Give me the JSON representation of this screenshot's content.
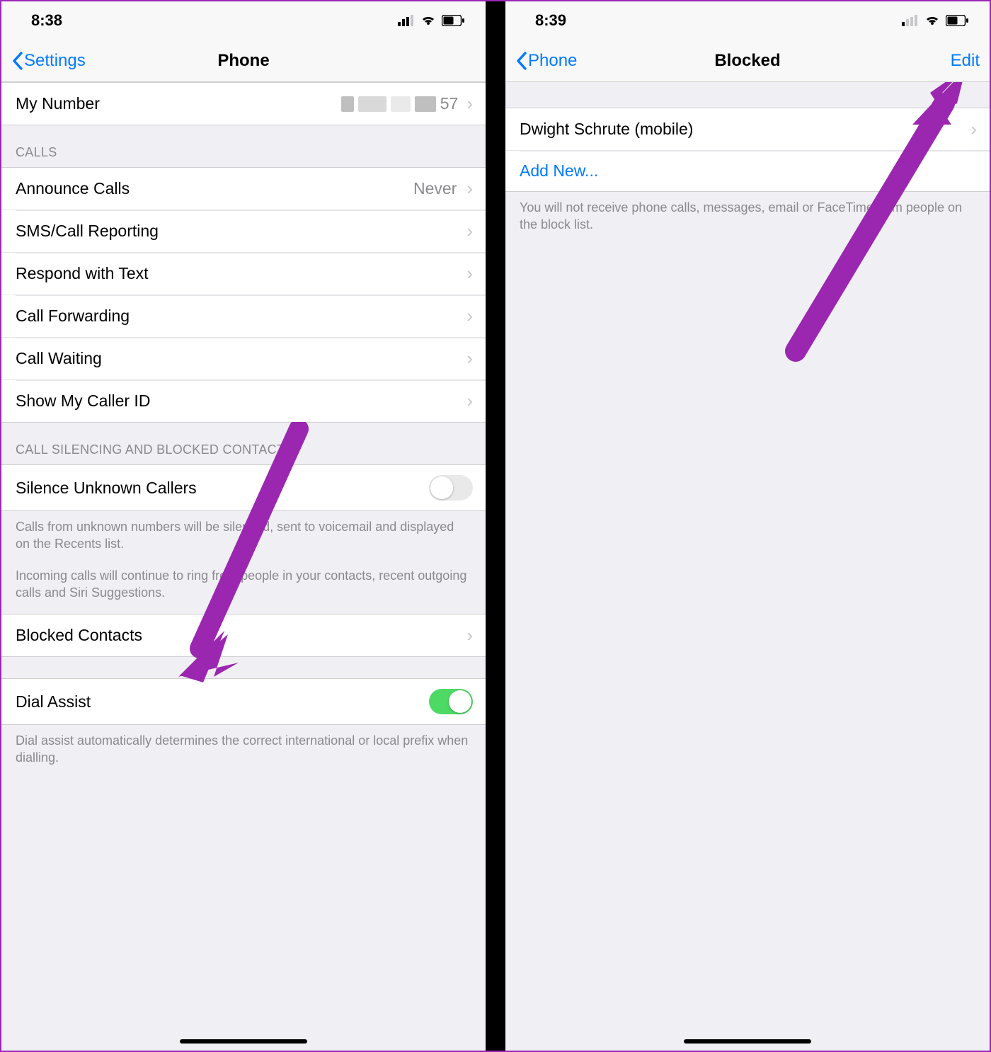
{
  "left": {
    "status_time": "8:38",
    "nav_back": "Settings",
    "nav_title": "Phone",
    "my_number_label": "My Number",
    "my_number_suffix": "57",
    "section_calls": "CALLS",
    "rows_calls": [
      {
        "label": "Announce Calls",
        "value": "Never"
      },
      {
        "label": "SMS/Call Reporting",
        "value": ""
      },
      {
        "label": "Respond with Text",
        "value": ""
      },
      {
        "label": "Call Forwarding",
        "value": ""
      },
      {
        "label": "Call Waiting",
        "value": ""
      },
      {
        "label": "Show My Caller ID",
        "value": ""
      }
    ],
    "section_silencing": "CALL SILENCING AND BLOCKED CONTACTS",
    "silence_label": "Silence Unknown Callers",
    "silence_on": false,
    "silence_footer1": "Calls from unknown numbers will be silenced, sent to voicemail and displayed on the Recents list.",
    "silence_footer2": "Incoming calls will continue to ring from people in your contacts, recent outgoing calls and Siri Suggestions.",
    "blocked_label": "Blocked Contacts",
    "dial_assist_label": "Dial Assist",
    "dial_assist_on": true,
    "dial_assist_footer": "Dial assist automatically determines the correct international or local prefix when dialling."
  },
  "right": {
    "status_time": "8:39",
    "nav_back": "Phone",
    "nav_title": "Blocked",
    "nav_right": "Edit",
    "blocked_items": [
      "Dwight Schrute (mobile)"
    ],
    "add_new": "Add New...",
    "footer": "You will not receive phone calls, messages, email or FaceTime from people on the block list."
  }
}
